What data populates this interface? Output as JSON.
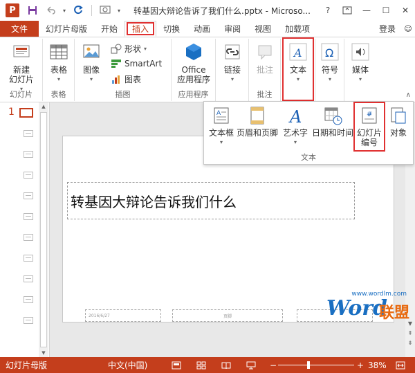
{
  "titlebar": {
    "app_icon": "P",
    "title": "转基因大辩论告诉了我们什么.pptx - Microso...",
    "help": "?",
    "restore_icon": "ribbon-display-icon",
    "minimize": "—",
    "maximize": "☐",
    "close": "✕"
  },
  "tabs": {
    "file": "文件",
    "items": [
      "幻灯片母版",
      "开始",
      "插入",
      "切换",
      "动画",
      "审阅",
      "视图",
      "加载项"
    ],
    "active": "插入",
    "login": "登录",
    "user_icon": "☺"
  },
  "ribbon": {
    "groups": {
      "slides": {
        "label": "幻灯片",
        "button": "新建\n幻灯片"
      },
      "tables": {
        "label": "表格",
        "button": "表格"
      },
      "images": {
        "label": "插图",
        "image": "图像",
        "shapes": "形状",
        "smartart": "SmartArt",
        "chart": "图表"
      },
      "apps": {
        "label": "应用程序",
        "button": "Office\n应用程序"
      },
      "links": {
        "button": "链接"
      },
      "comments": {
        "label": "批注",
        "button": "批注"
      },
      "text": {
        "button": "文本"
      },
      "symbols": {
        "button": "符号"
      },
      "media": {
        "button": "媒体"
      }
    },
    "collapse": "∧"
  },
  "text_panel": {
    "label": "文本",
    "buttons": {
      "textbox": "文本框",
      "header_footer": "页眉和页脚",
      "wordart": "艺术字",
      "datetime": "日期和时间",
      "slide_number": "幻灯片\n编号",
      "object": "对象"
    }
  },
  "thumbs": {
    "number": "1"
  },
  "slide": {
    "title": "转基因大辩论告诉我们什么",
    "footer_date": "2016/6/27",
    "footer_center": "页脚"
  },
  "watermark": {
    "url": "www.wordlm.com",
    "word": "Word",
    "cn": "联盟"
  },
  "status": {
    "mode": "幻灯片母版",
    "lang": "中文(中国)",
    "minus": "−",
    "plus": "+",
    "zoom": "38%"
  },
  "colors": {
    "accent": "#c43e1c",
    "highlight": "#e03030"
  }
}
